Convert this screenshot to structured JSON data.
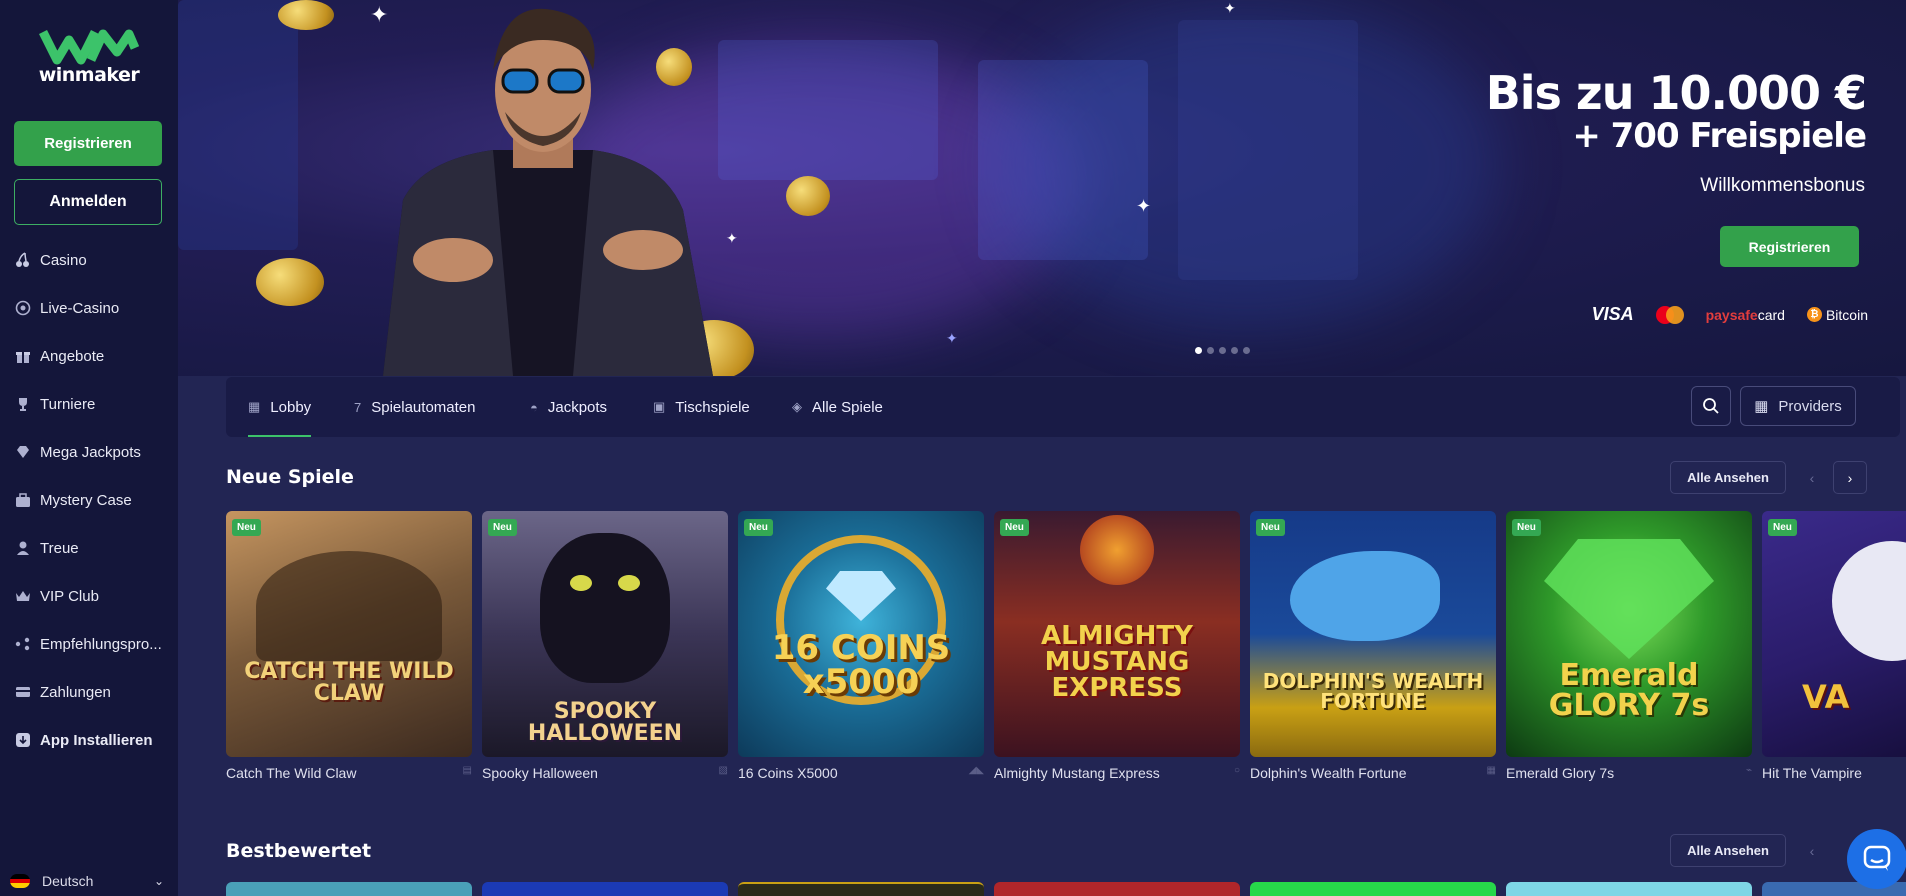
{
  "brand": {
    "logo_text": "winmaker",
    "logo_color": "#3cc36a"
  },
  "sidebar": {
    "register_label": "Registrieren",
    "login_label": "Anmelden",
    "items": [
      {
        "label": "Casino",
        "icon": "cherries-icon"
      },
      {
        "label": "Live-Casino",
        "icon": "poker-chip-icon"
      },
      {
        "label": "Angebote",
        "icon": "gift-icon"
      },
      {
        "label": "Turniere",
        "icon": "trophy-icon"
      },
      {
        "label": "Mega Jackpots",
        "icon": "diamond-icon"
      },
      {
        "label": "Mystery Case",
        "icon": "briefcase-icon"
      },
      {
        "label": "Treue",
        "icon": "loyalty-icon"
      },
      {
        "label": "VIP Club",
        "icon": "crown-icon"
      },
      {
        "label": "Empfehlungspro...",
        "icon": "referral-icon"
      },
      {
        "label": "Zahlungen",
        "icon": "wallet-icon"
      },
      {
        "label": "App Installieren",
        "icon": "install-app-icon"
      }
    ],
    "language": "Deutsch"
  },
  "hero": {
    "headline_1": "Bis zu 10.000 €",
    "headline_2": "+ 700 Freispiele",
    "subline": "Willkommensbonus",
    "cta_label": "Registrieren",
    "payments": {
      "visa": "VISA",
      "paysafe_prefix": "paysafe",
      "paysafe_suffix": "card",
      "bitcoin": "Bitcoin"
    },
    "slides": 5,
    "active_slide": 1
  },
  "tabs": [
    {
      "label": "Lobby",
      "icon": "grid-icon",
      "active": true
    },
    {
      "label": "Spielautomaten",
      "icon": "slot-icon",
      "active": false
    },
    {
      "label": "Jackpots",
      "icon": "jackpot-icon",
      "active": false
    },
    {
      "label": "Tischspiele",
      "icon": "cards-icon",
      "active": false
    },
    {
      "label": "Alle Spiele",
      "icon": "all-games-icon",
      "active": false
    }
  ],
  "providers_label": "Providers",
  "sections": {
    "new_games": {
      "title": "Neue Spiele",
      "view_all": "Alle Ansehen",
      "badge": "Neu",
      "games": [
        {
          "name": "Catch The Wild Claw",
          "art": "CATCH THE WILD CLAW",
          "colors": [
            "#7a5a3a",
            "#3c2a1f"
          ]
        },
        {
          "name": "Spooky Halloween",
          "art": "SPOOKY HALLOWEEN",
          "colors": [
            "#4b4560",
            "#1f1b2d"
          ]
        },
        {
          "name": "16 Coins X5000",
          "art": "16 COINS x5000",
          "colors": [
            "#2a8bb6",
            "#0d3a5a"
          ]
        },
        {
          "name": "Almighty Mustang Express",
          "art": "ALMIGHTY MUSTANG EXPRESS",
          "colors": [
            "#c4472a",
            "#3c1220"
          ]
        },
        {
          "name": "Dolphin's Wealth Fortune",
          "art": "DOLPHIN'S WEALTH FORTUNE",
          "colors": [
            "#1a4a9a",
            "#b98a14"
          ]
        },
        {
          "name": "Emerald Glory 7s",
          "art": "Emerald GLORY 7s",
          "colors": [
            "#2f9a2a",
            "#0d3a12"
          ]
        },
        {
          "name": "Hit The Vampire",
          "art": "VA",
          "colors": [
            "#2a1c6a",
            "#120c33"
          ]
        }
      ]
    },
    "top_rated": {
      "title": "Bestbewertet",
      "view_all": "Alle Ansehen"
    }
  }
}
